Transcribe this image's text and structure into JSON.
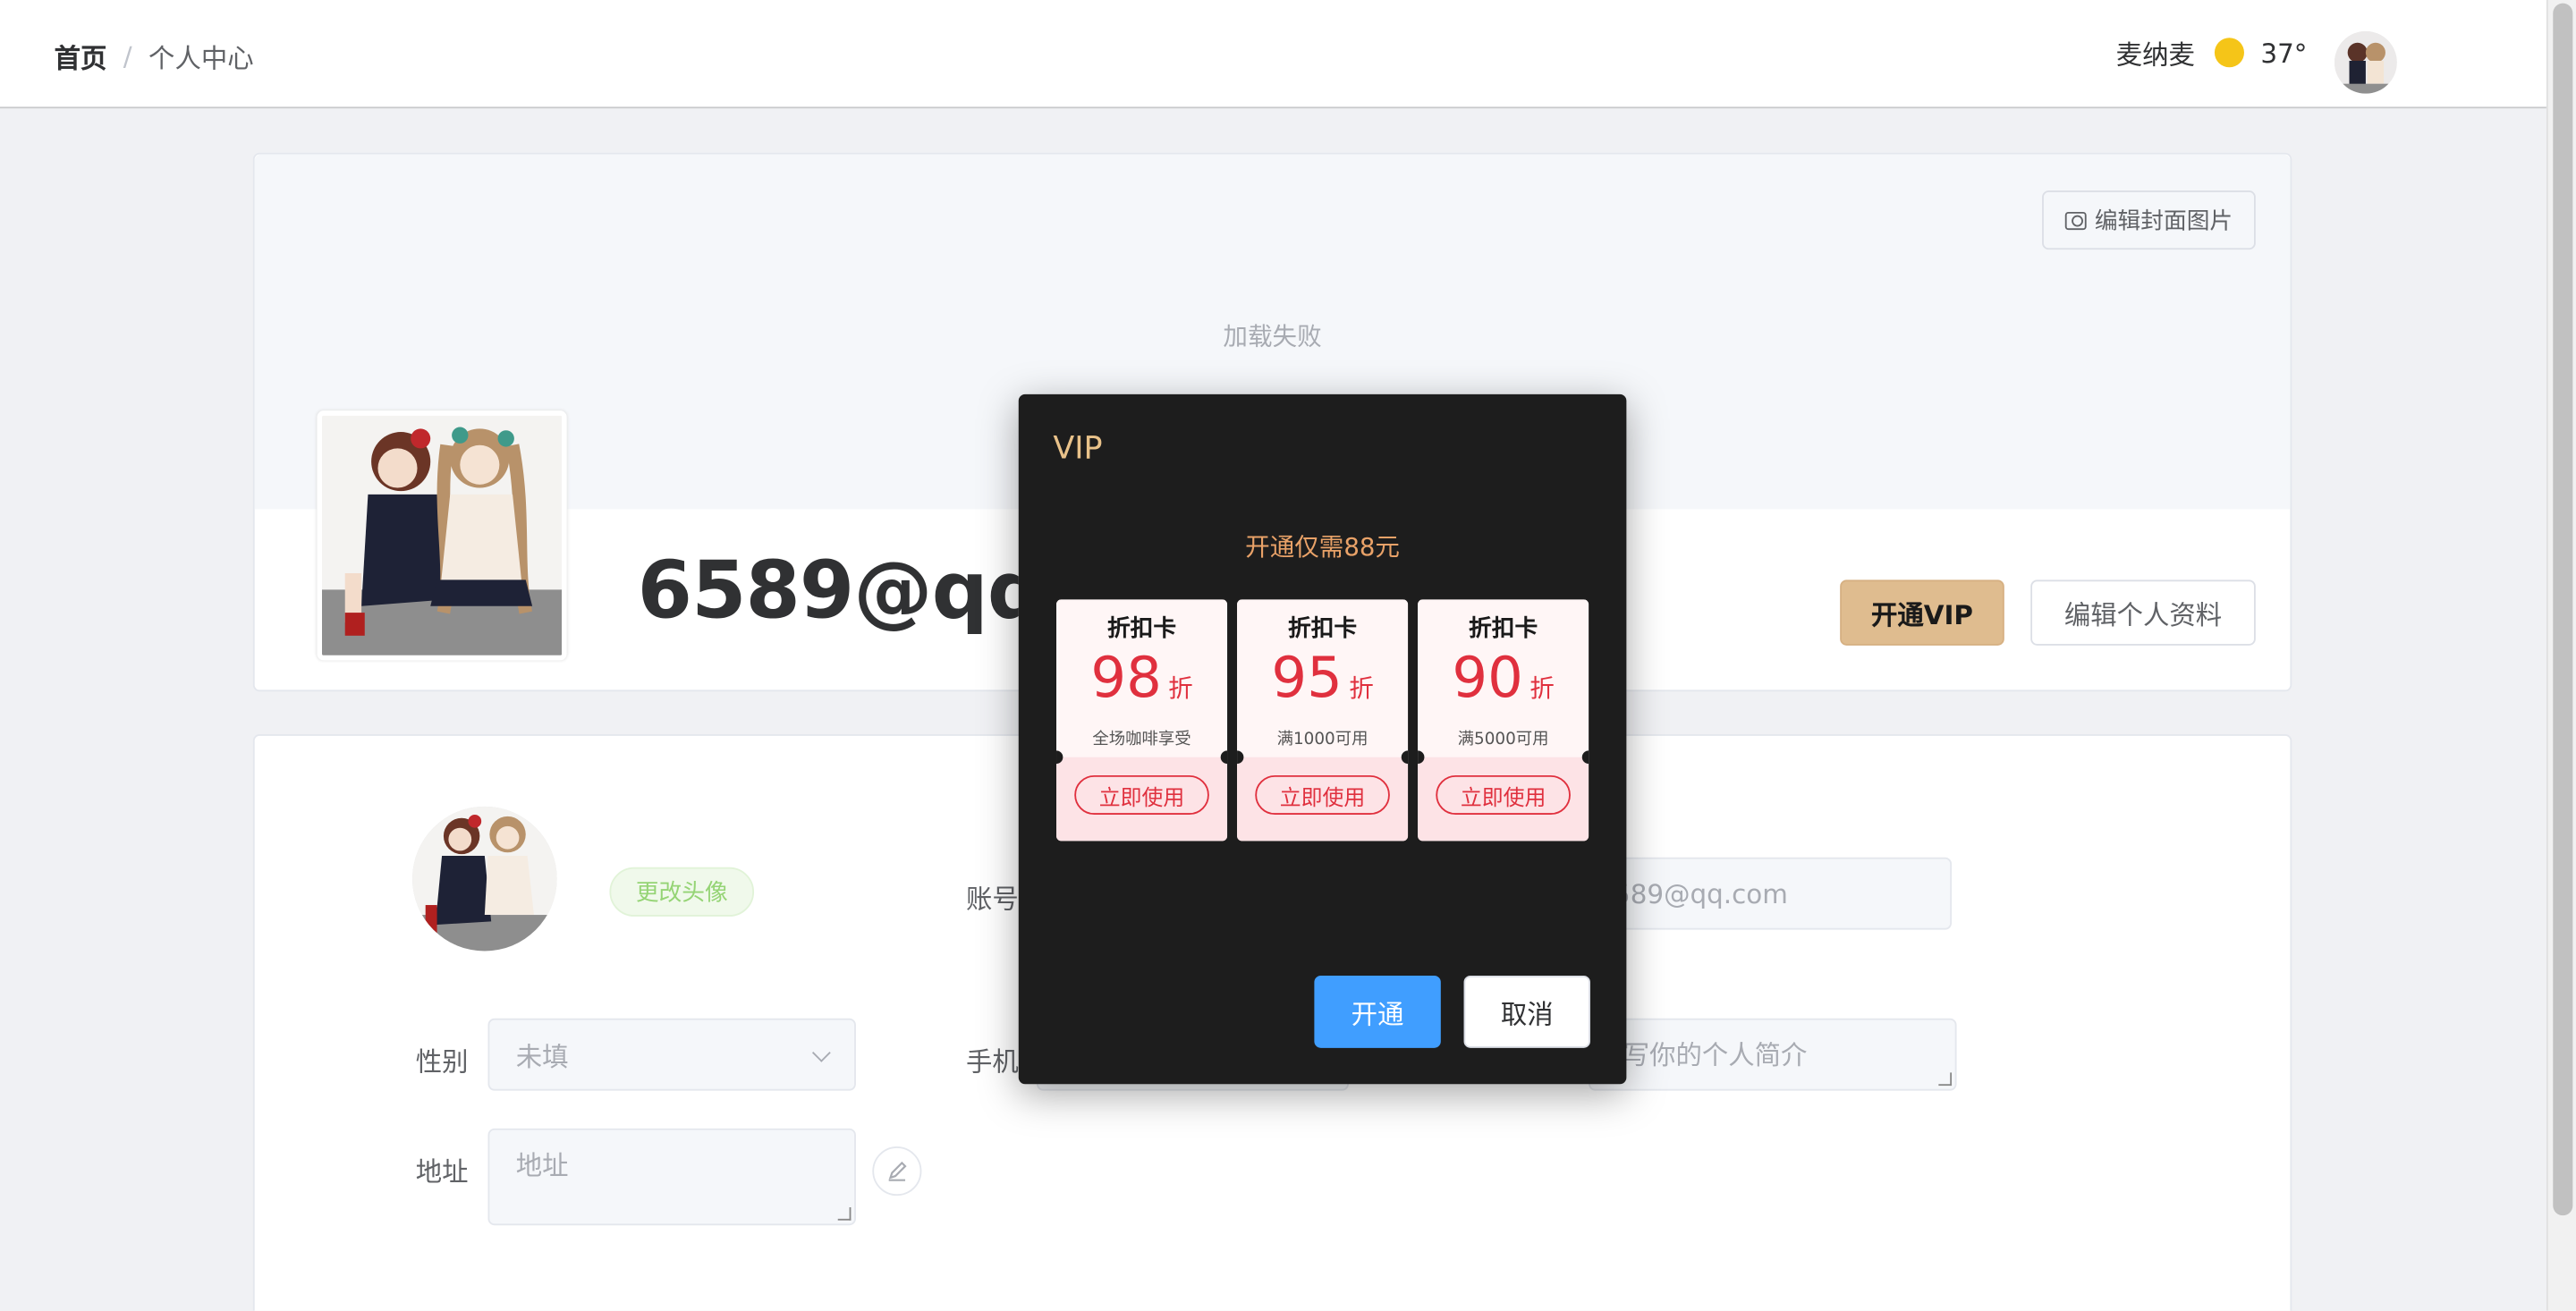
{
  "header": {
    "breadcrumb_home": "首页",
    "breadcrumb_sep": "/",
    "breadcrumb_current": "个人中心",
    "city": "麦纳麦",
    "temperature": "37°",
    "weather_icon": "sun-icon"
  },
  "cover": {
    "edit_cover_label": "编辑封面图片",
    "load_failed": "加载失败",
    "username": "6589@qq.",
    "vip_button": "开通VIP",
    "edit_profile_button": "编辑个人资料"
  },
  "form": {
    "change_avatar": "更改头像",
    "account_label": "账号",
    "account_value": "6589@qq.com",
    "gender_label": "性别",
    "gender_value": "未填",
    "phone_label": "手机",
    "intro_placeholder": "填写你的个人简介",
    "address_label": "地址",
    "address_placeholder": "地址"
  },
  "dialog": {
    "title": "VIP",
    "subtitle": "开通仅需88元",
    "coupons": [
      {
        "title": "折扣卡",
        "value": "98",
        "unit": "折",
        "desc": "全场咖啡享受",
        "button": "立即使用"
      },
      {
        "title": "折扣卡",
        "value": "95",
        "unit": "折",
        "desc": "满1000可用",
        "button": "立即使用"
      },
      {
        "title": "折扣卡",
        "value": "90",
        "unit": "折",
        "desc": "满5000可用",
        "button": "立即使用"
      }
    ],
    "confirm": "开通",
    "cancel": "取消"
  },
  "colors": {
    "vip_gold": "#dfbc8f",
    "primary": "#409eff",
    "coupon_red": "#e0303e",
    "dialog_bg": "#1d1d1d"
  }
}
